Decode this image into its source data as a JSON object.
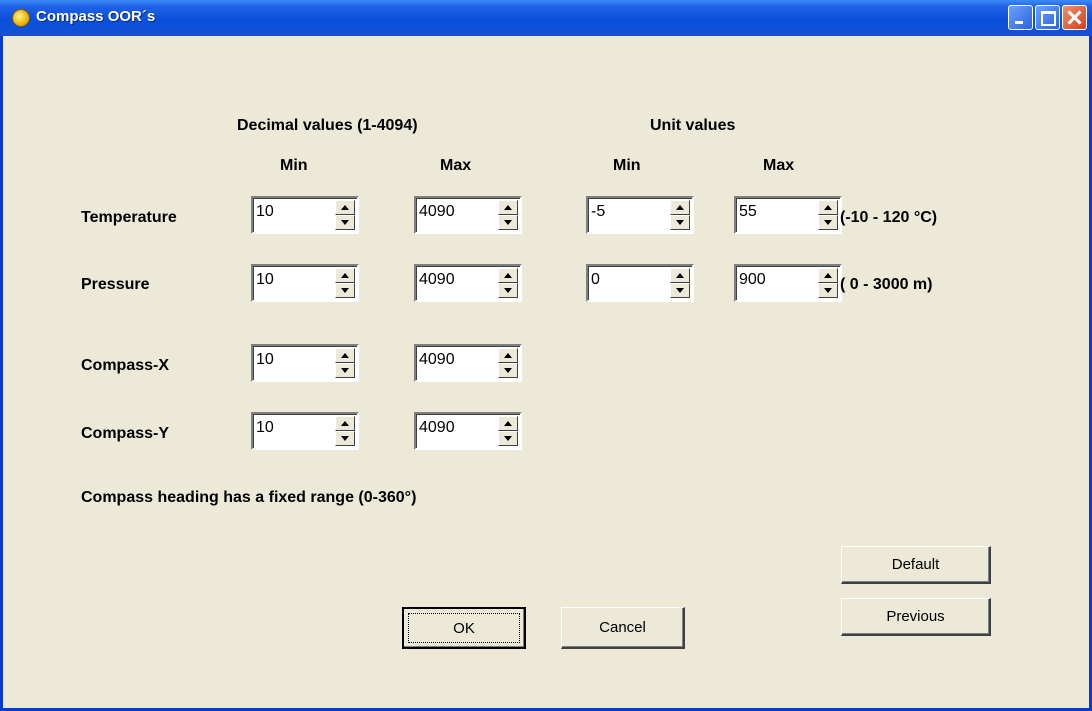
{
  "window": {
    "title": "Compass OOR´s"
  },
  "headers": {
    "decimal": "Decimal values (1-4094)",
    "unit": "Unit values",
    "min": "Min",
    "max": "Max"
  },
  "rows": {
    "temperature": {
      "label": "Temperature",
      "dec_min": "10",
      "dec_max": "4090",
      "unit_min": "-5",
      "unit_max": "55",
      "range": "(-10  -  120 °C)"
    },
    "pressure": {
      "label": "Pressure",
      "dec_min": "10",
      "dec_max": "4090",
      "unit_min": "0",
      "unit_max": "900",
      "range": "( 0  -  3000 m)"
    },
    "compass_x": {
      "label": "Compass-X",
      "dec_min": "10",
      "dec_max": "4090"
    },
    "compass_y": {
      "label": "Compass-Y",
      "dec_min": "10",
      "dec_max": "4090"
    }
  },
  "note": "Compass heading has a fixed range (0-360°)",
  "buttons": {
    "default": "Default",
    "previous": "Previous",
    "ok": "OK",
    "cancel": "Cancel"
  },
  "icons": {
    "app": "compass-app-icon",
    "minimize": "minimize-icon",
    "maximize": "maximize-icon",
    "close": "close-icon",
    "up": "arrow-up-icon",
    "down": "arrow-down-icon"
  }
}
